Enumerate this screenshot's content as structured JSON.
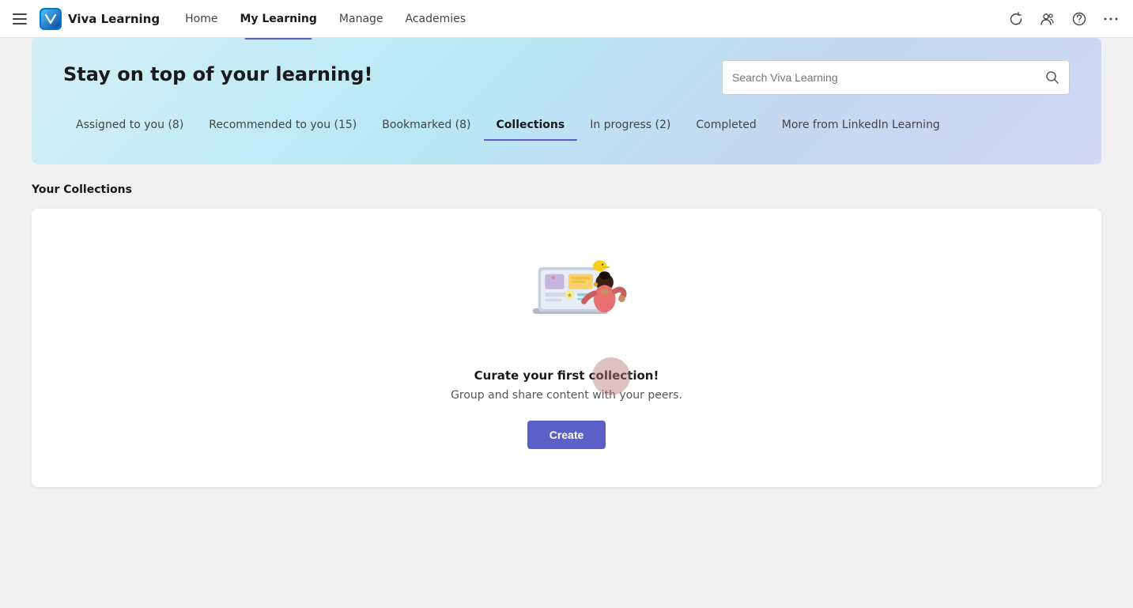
{
  "app": {
    "name": "Viva Learning",
    "logo_alt": "Viva Learning Logo"
  },
  "nav": {
    "home_label": "Home",
    "my_learning_label": "My Learning",
    "manage_label": "Manage",
    "academies_label": "Academies",
    "active": "My Learning"
  },
  "nav_icons": {
    "refresh": "↻",
    "share": "⚙",
    "help": "?",
    "more": "…"
  },
  "hero": {
    "title": "Stay on top of your learning!",
    "search_placeholder": "Search Viva Learning"
  },
  "tabs": [
    {
      "id": "assigned",
      "label": "Assigned to you (8)"
    },
    {
      "id": "recommended",
      "label": "Recommended to you (15)"
    },
    {
      "id": "bookmarked",
      "label": "Bookmarked (8)"
    },
    {
      "id": "collections",
      "label": "Collections"
    },
    {
      "id": "in_progress",
      "label": "In progress (2)"
    },
    {
      "id": "completed",
      "label": "Completed"
    },
    {
      "id": "linkedin",
      "label": "More from LinkedIn Learning"
    }
  ],
  "active_tab": "collections",
  "section": {
    "title": "Your Collections"
  },
  "empty_state": {
    "title": "Curate your first collection!",
    "subtitle": "Group and share content with your peers.",
    "create_label": "Create"
  }
}
